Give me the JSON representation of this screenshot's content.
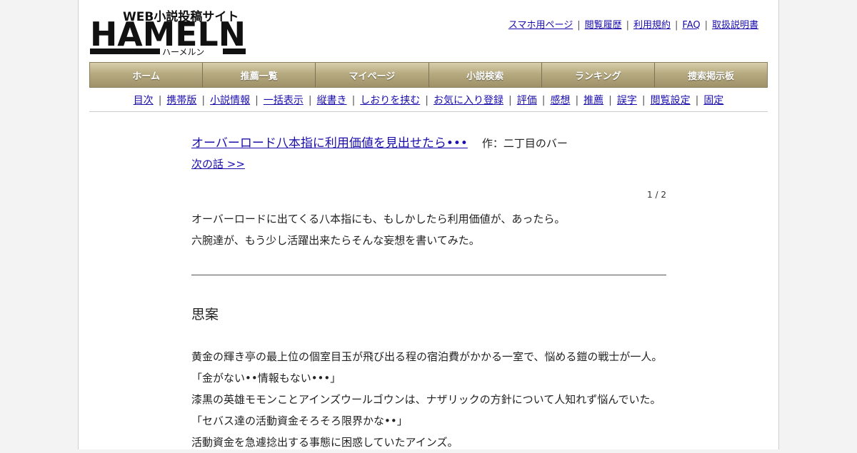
{
  "logo": {
    "tagline": "WEB小説投稿サイト",
    "wordmark": "HAMELN",
    "kana": "ハーメルン"
  },
  "top_links": [
    "スマホ用ページ",
    "閲覧履歴",
    "利用規約",
    "FAQ",
    "取扱説明書"
  ],
  "main_nav": [
    "ホーム",
    "推薦一覧",
    "マイページ",
    "小説検索",
    "ランキング",
    "捜索掲示板"
  ],
  "sub_nav": [
    "目次",
    "携帯版",
    "小説情報",
    "一括表示",
    "縦書き",
    "しおりを挟む",
    "お気に入り登録",
    "評価",
    "感想",
    "推薦",
    "誤字",
    "閲覧設定",
    "固定"
  ],
  "novel": {
    "title": "オーバーロード八本指に利用価値を見出せたら•••",
    "author": "作：二丁目のバー",
    "next_label": "次の話 >>",
    "page_count": "1 / 2"
  },
  "synopsis": [
    "オーバーロードに出てくる八本指にも、もしかしたら利用価値が、あったら。",
    "六腕達が、もう少し活躍出来たらそんな妄想を書いてみた。"
  ],
  "chapter": {
    "title": "思案",
    "lines": [
      "黄金の輝き亭の最上位の個室目玉が飛び出る程の宿泊費がかかる一室で、悩める鎧の戦士が一人。",
      "「金がない••情報もない•••」",
      "漆黒の英雄モモンことアインズウールゴウンは、ナザリックの方針について人知れず悩んでいた。",
      "「セバス達の活動資金そろそろ限界かな••」",
      "活動資金を急遽捻出する事態に困惑していたアインズ。"
    ]
  },
  "colors": {
    "link": "#1a0dab",
    "nav_bar": "#b6aa80",
    "logo": "#111111"
  }
}
